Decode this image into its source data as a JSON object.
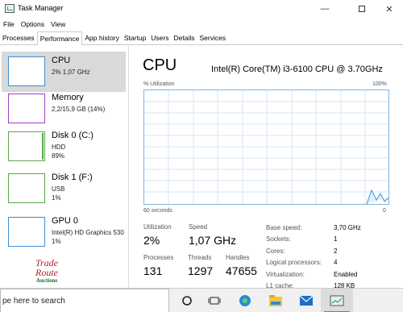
{
  "window": {
    "title": "Task Manager",
    "minimize_glyph": "—",
    "close_glyph": "✕"
  },
  "menu": [
    "File",
    "Options",
    "View"
  ],
  "tabs": [
    {
      "label": "Processes",
      "active": false
    },
    {
      "label": "Performance",
      "active": true
    },
    {
      "label": "App history",
      "active": false
    },
    {
      "label": "Startup",
      "active": false
    },
    {
      "label": "Users",
      "active": false
    },
    {
      "label": "Details",
      "active": false
    },
    {
      "label": "Services",
      "active": false
    }
  ],
  "sidebar": {
    "items": [
      {
        "name": "CPU",
        "sub1": "2% 1,07 GHz",
        "sub2": "",
        "sub3": ""
      },
      {
        "name": "Memory",
        "sub1": "2,2/15,9 GB (14%)",
        "sub2": "",
        "sub3": ""
      },
      {
        "name": "Disk 0 (C:)",
        "sub1": "HDD",
        "sub2": "89%",
        "sub3": ""
      },
      {
        "name": "Disk 1 (F:)",
        "sub1": "USB",
        "sub2": "1%",
        "sub3": ""
      },
      {
        "name": "GPU 0",
        "sub1": "Intel(R) HD Graphics 530",
        "sub2": "1%",
        "sub3": ""
      }
    ]
  },
  "main": {
    "title": "CPU",
    "model": "Intel(R) Core(TM) i3-6100 CPU @ 3.70GHz",
    "graph_label": "% Utilization",
    "graph_max": "100%",
    "graph_time": "60 seconds",
    "graph_min": "0",
    "stats": {
      "utilization_label": "Utilization",
      "utilization_value": "2%",
      "speed_label": "Speed",
      "speed_value": "1,07 GHz",
      "processes_label": "Processes",
      "processes_value": "131",
      "threads_label": "Threads",
      "threads_value": "1297",
      "handles_label": "Handles",
      "handles_value": "47655"
    },
    "details": [
      {
        "label": "Base speed:",
        "value": "3,70 GHz"
      },
      {
        "label": "Sockets:",
        "value": "1"
      },
      {
        "label": "Cores:",
        "value": "2"
      },
      {
        "label": "Logical processors:",
        "value": "4"
      },
      {
        "label": "Virtualization:",
        "value": "Enabled"
      },
      {
        "label": "L1 cache:",
        "value": "128 KB"
      }
    ]
  },
  "logo": {
    "line1": "Trade",
    "line2": "Route",
    "line3": "Auctions"
  },
  "taskbar": {
    "search_text": "pe here to search"
  },
  "colors": {
    "cpu_accent": "#3b8ed4",
    "memory_accent": "#9b3fc4",
    "disk_accent": "#5aa84a"
  }
}
